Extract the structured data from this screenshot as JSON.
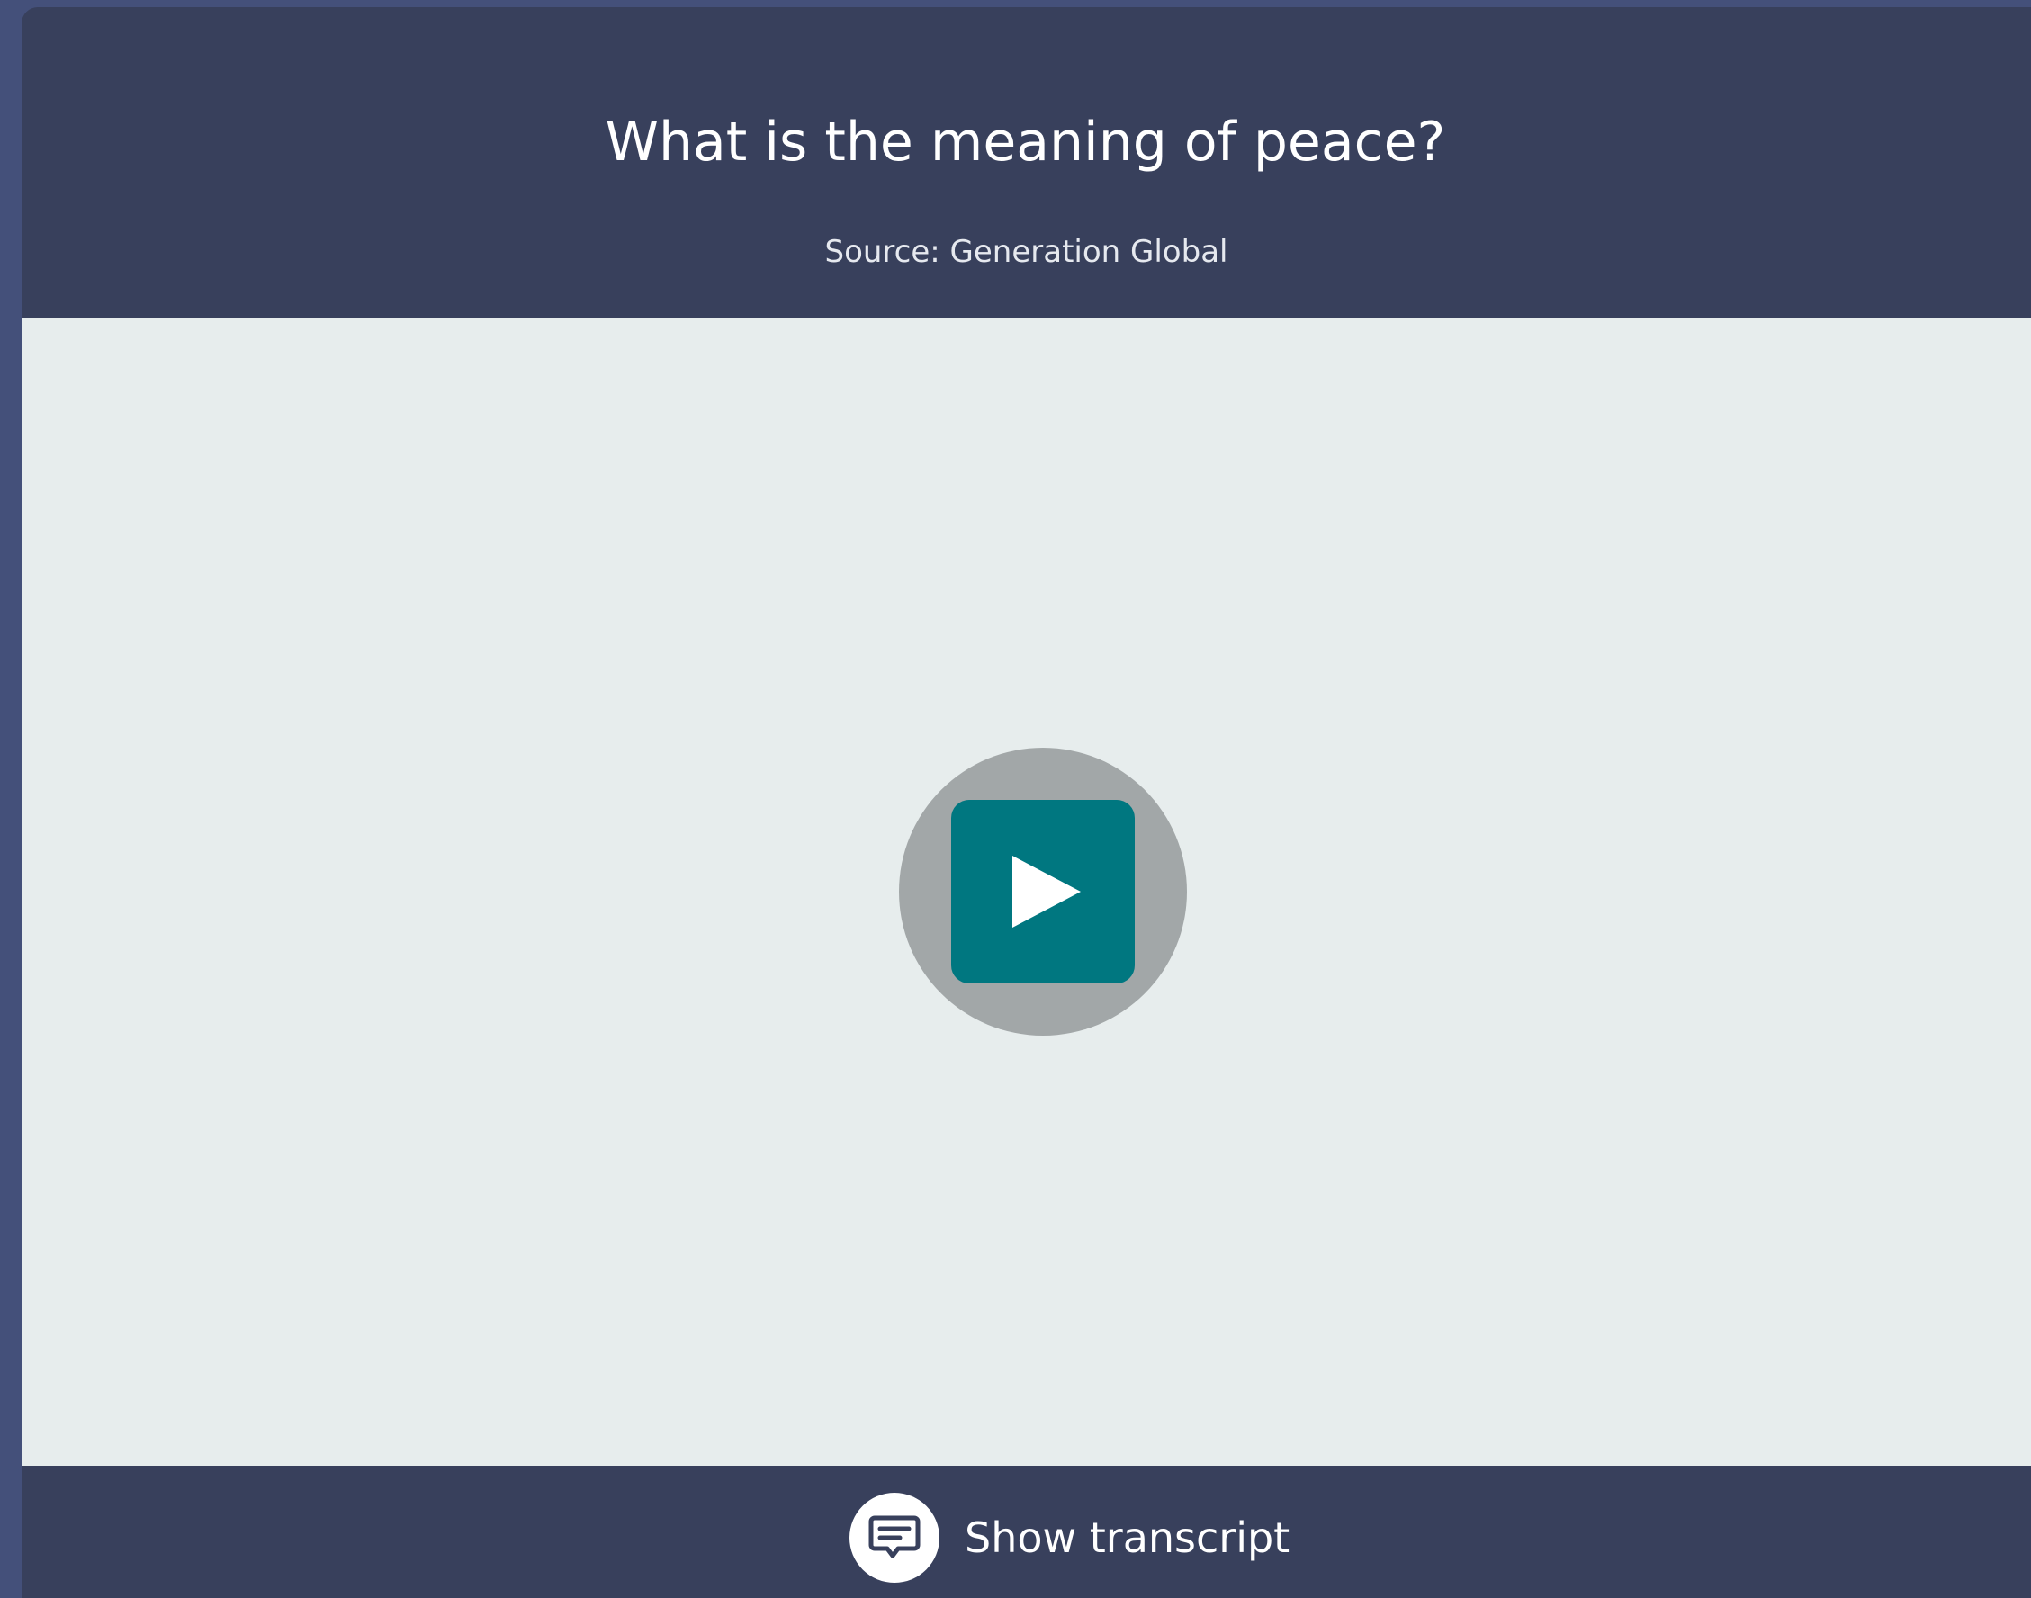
{
  "video_card": {
    "title": "What is the meaning of peace?",
    "source": "Source: Generation Global",
    "play_icon": "play-icon",
    "transcript_icon": "speech-bubble-icon",
    "transcript_label": "Show transcript"
  },
  "colors": {
    "page_background": "#44507a",
    "card_background": "#38405c",
    "video_background": "#e7eded",
    "play_ring": "#a2a7a8",
    "play_button": "#007780",
    "text": "#ffffff"
  }
}
